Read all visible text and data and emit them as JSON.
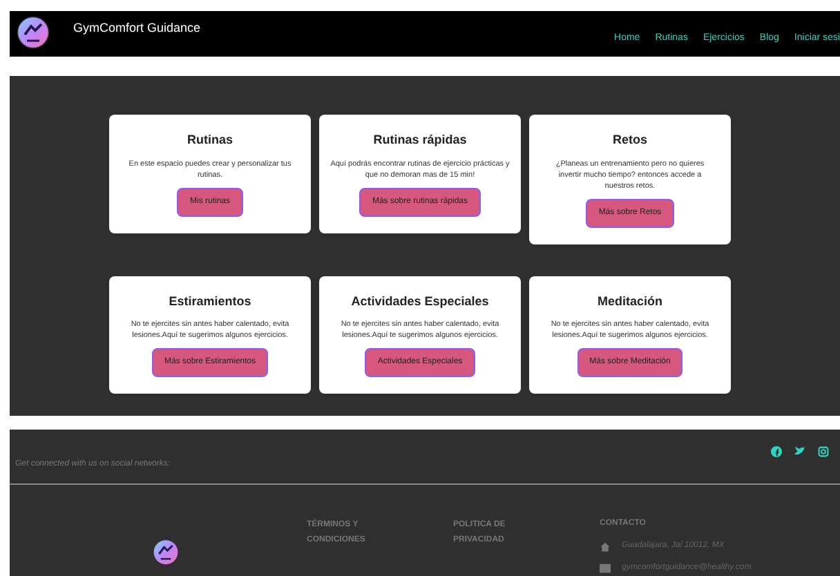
{
  "header": {
    "title": "GymComfort Guidance",
    "nav": [
      {
        "label": "Home"
      },
      {
        "label": "Rutinas"
      },
      {
        "label": "Ejercicios"
      },
      {
        "label": "Blog"
      },
      {
        "label": "Iniciar sesi"
      }
    ]
  },
  "cards": [
    {
      "title": "Rutinas",
      "text": "En este espacio puedes crear y personalizar tus rutinas.",
      "button": "Mis rutinas"
    },
    {
      "title": "Rutinas rápidas",
      "text": "Aquí podrás encontrar rutinas de ejercicio prácticas y que no demoran mas de 15 min!",
      "button": "Más sobre rutinas rápidas"
    },
    {
      "title": "Retos",
      "text": "¿Planeas un entrenamiento pero no quieres invertir mucho tiempo? entonces accede a nuestros retos.",
      "button": "Más sobre Retos"
    },
    {
      "title": "Estiramientos",
      "text": "No te ejercites sin antes haber calentado, evita lesiones.Aquí te sugerimos algunos ejercicios.",
      "button": "Más sobre Estiramientos"
    },
    {
      "title": "Actividades Especiales",
      "text": "No te ejercites sin antes haber calentado, evita lesiones.Aquí te sugerimos algunos ejercicios.",
      "button": "Actividades Especiales"
    },
    {
      "title": "Meditación",
      "text": "No te ejercites sin antes haber calentado, evita lesiones.Aquí te sugerimos algunos ejercicios.",
      "button": "Más sobre Meditación"
    }
  ],
  "footer": {
    "social_text": "Get connected with us on social networks:",
    "columns": [
      {
        "title": "TÉRMINOS Y CONDICIONES"
      },
      {
        "title": "POLITICA DE PRIVACIDAD"
      }
    ],
    "contact": {
      "title": "CONTACTO",
      "items": [
        {
          "kind": "address",
          "text": "Guadalajara, Jal 10012, MX"
        },
        {
          "kind": "email",
          "text": "gymcomfortguidance@healthy.com"
        }
      ]
    }
  }
}
